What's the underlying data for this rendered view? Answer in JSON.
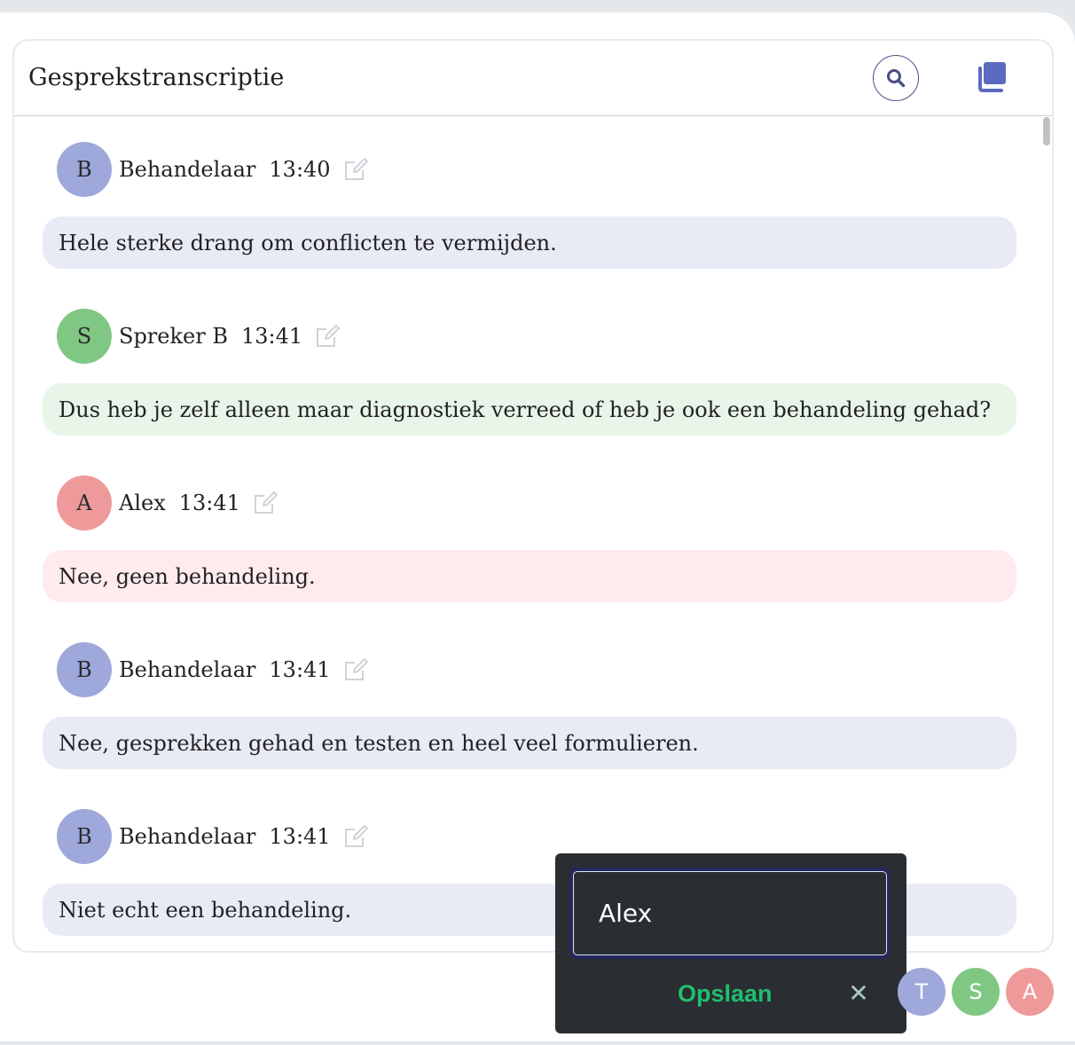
{
  "header": {
    "title": "Gesprekstranscriptie",
    "search_icon": "search-icon",
    "copy_icon": "copy-icon"
  },
  "colors": {
    "Behandelaar": {
      "avatar": "#9fa8da",
      "bubble": "#e8eaf6"
    },
    "Spreker B": {
      "avatar": "#81c784",
      "bubble": "#e8f5e9"
    },
    "Alex": {
      "avatar": "#ef9a9a",
      "bubble": "#ffebee"
    },
    "accent": "#4a4f86"
  },
  "transcript": [
    {
      "initial": "B",
      "speaker": "Behandelaar",
      "time": "13:40",
      "text": "Hele sterke drang om conflicten te vermijden.",
      "avatar_color": "#9fa8da",
      "bubble_color": "#e8eaf6"
    },
    {
      "initial": "S",
      "speaker": "Spreker B",
      "time": "13:41",
      "text": "Dus heb je zelf alleen maar diagnostiek verreed of heb je ook een behandeling gehad?",
      "avatar_color": "#81c784",
      "bubble_color": "#e8f5e9"
    },
    {
      "initial": "A",
      "speaker": "Alex",
      "time": "13:41",
      "text": "Nee, geen behandeling.",
      "avatar_color": "#ef9a9a",
      "bubble_color": "#ffebee"
    },
    {
      "initial": "B",
      "speaker": "Behandelaar",
      "time": "13:41",
      "text": "Nee, gesprekken gehad en testen en heel veel formulieren.",
      "avatar_color": "#9fa8da",
      "bubble_color": "#e8eaf6"
    },
    {
      "initial": "B",
      "speaker": "Behandelaar",
      "time": "13:41",
      "text": "Niet echt een behandeling.",
      "avatar_color": "#9fa8da",
      "bubble_color": "#e8eaf6"
    }
  ],
  "rename_popup": {
    "input_value": "Alex",
    "save_label": "Opslaan",
    "close_label": "✕"
  },
  "speaker_chips": [
    {
      "initial": "T",
      "color": "#9fa8da"
    },
    {
      "initial": "S",
      "color": "#81c784"
    },
    {
      "initial": "A",
      "color": "#ef9a9a"
    }
  ]
}
